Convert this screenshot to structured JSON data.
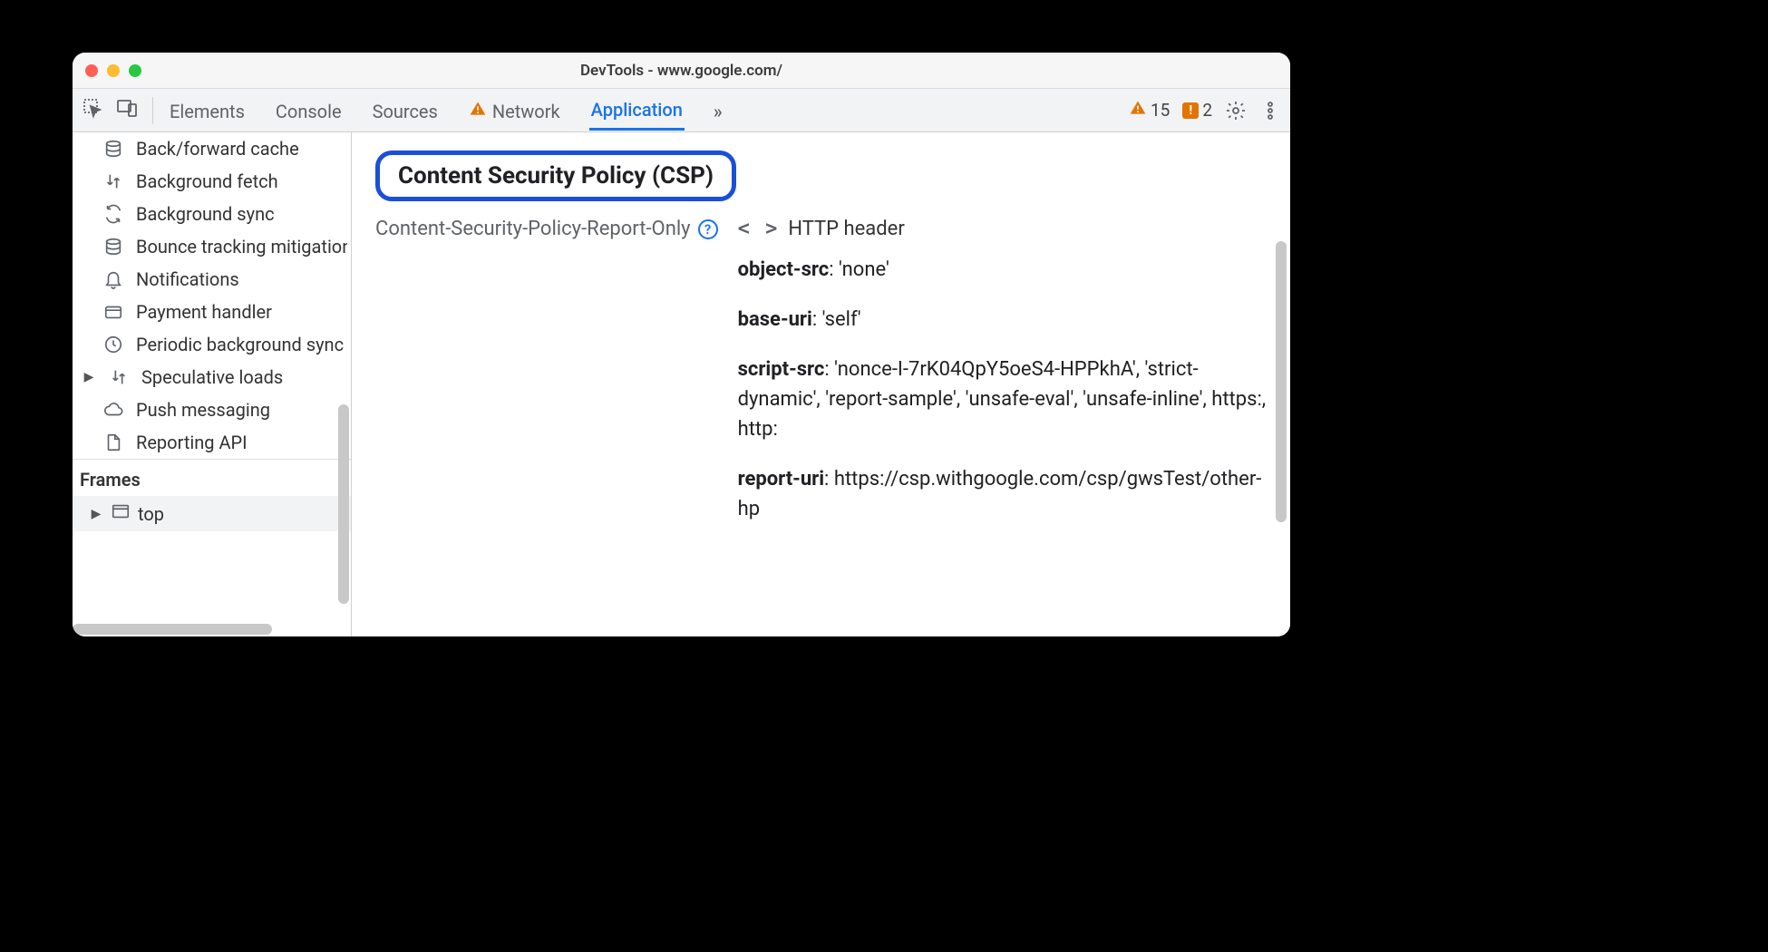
{
  "window": {
    "title": "DevTools - www.google.com/"
  },
  "toolbar": {
    "tabs": [
      {
        "label": "Elements",
        "active": false
      },
      {
        "label": "Console",
        "active": false
      },
      {
        "label": "Sources",
        "active": false
      },
      {
        "label": "Network",
        "active": false,
        "warning": true
      },
      {
        "label": "Application",
        "active": true
      }
    ],
    "more_tabs_glyph": "»",
    "warnings_count": "15",
    "issues_count": "2"
  },
  "sidebar": {
    "items": [
      {
        "label": "Back/forward cache",
        "icon": "database"
      },
      {
        "label": "Background fetch",
        "icon": "transfer"
      },
      {
        "label": "Background sync",
        "icon": "sync"
      },
      {
        "label": "Bounce tracking mitigations",
        "icon": "database"
      },
      {
        "label": "Notifications",
        "icon": "bell"
      },
      {
        "label": "Payment handler",
        "icon": "card"
      },
      {
        "label": "Periodic background sync",
        "icon": "clock"
      },
      {
        "label": "Speculative loads",
        "icon": "transfer",
        "has_arrow": true
      },
      {
        "label": "Push messaging",
        "icon": "cloud"
      },
      {
        "label": "Reporting API",
        "icon": "file"
      }
    ],
    "section_header": "Frames",
    "frames": [
      {
        "label": "top"
      }
    ]
  },
  "main": {
    "heading": "Content Security Policy (CSP)",
    "policy_name": "Content-Security-Policy-Report-Only",
    "source_label": "HTTP header",
    "directives": [
      {
        "name": "object-src",
        "value": "'none'"
      },
      {
        "name": "base-uri",
        "value": "'self'"
      },
      {
        "name": "script-src",
        "value": "'nonce-I-7rK04QpY5oeS4-HPPkhA', 'strict-dynamic', 'report-sample', 'unsafe-eval', 'unsafe-inline', https:, http:"
      },
      {
        "name": "report-uri",
        "value": "https://csp.withgoogle.com/csp/gwsTest/other-hp"
      }
    ]
  }
}
